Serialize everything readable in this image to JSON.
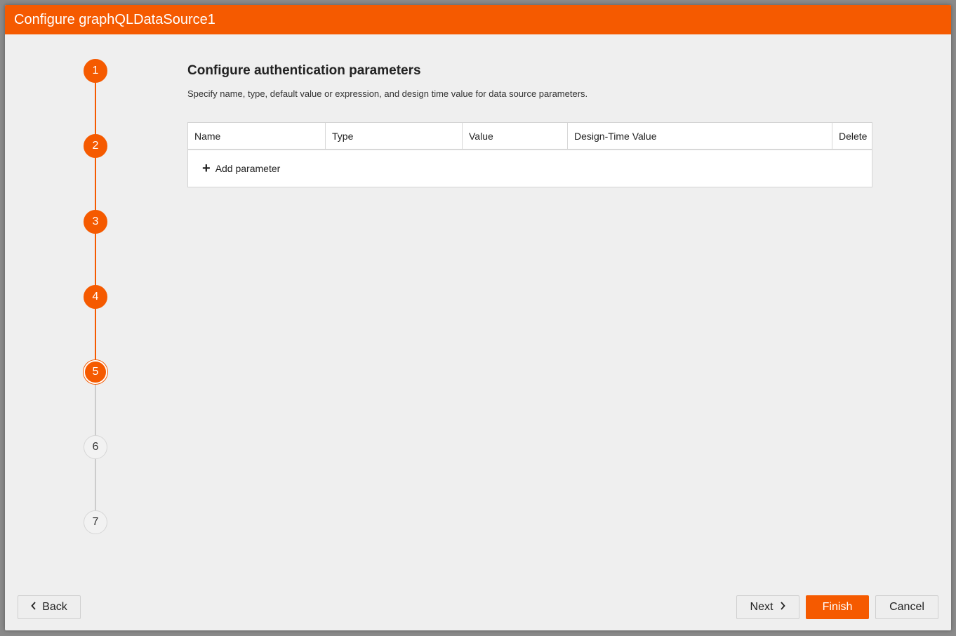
{
  "dialog": {
    "title": "Configure graphQLDataSource1"
  },
  "stepper": {
    "steps": [
      {
        "label": "1",
        "state": "done"
      },
      {
        "label": "2",
        "state": "done"
      },
      {
        "label": "3",
        "state": "done"
      },
      {
        "label": "4",
        "state": "done"
      },
      {
        "label": "5",
        "state": "current"
      },
      {
        "label": "6",
        "state": "todo"
      },
      {
        "label": "7",
        "state": "todo"
      }
    ]
  },
  "main": {
    "heading": "Configure authentication parameters",
    "description": "Specify name, type, default value or expression, and design time value for data source parameters.",
    "table": {
      "columns": [
        "Name",
        "Type",
        "Value",
        "Design-Time Value",
        "Delete"
      ],
      "add_label": "Add parameter"
    }
  },
  "footer": {
    "back_label": "Back",
    "next_label": "Next",
    "finish_label": "Finish",
    "cancel_label": "Cancel"
  },
  "colors": {
    "accent": "#f55a00",
    "inactive_line": "#cccccc"
  }
}
